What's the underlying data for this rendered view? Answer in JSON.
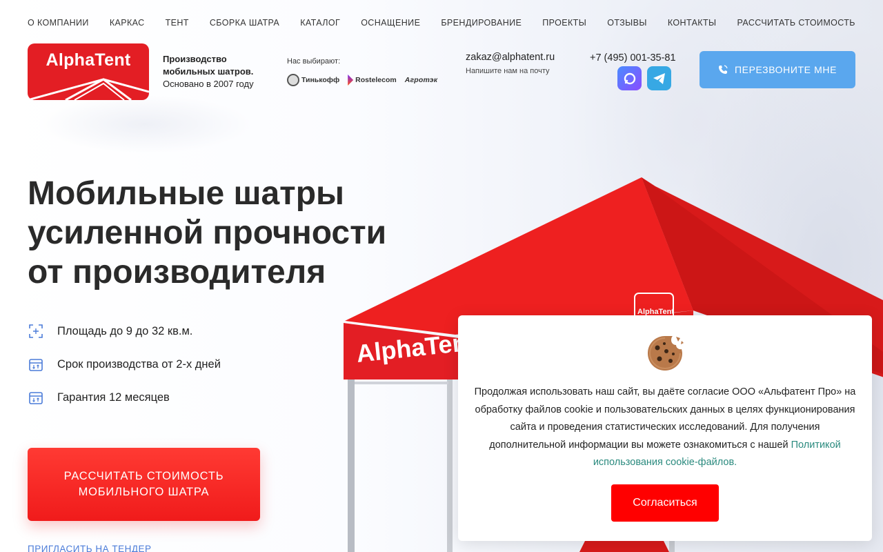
{
  "nav": {
    "items": [
      {
        "label": "О КОМПАНИИ"
      },
      {
        "label": "КАРКАС"
      },
      {
        "label": "ТЕНТ"
      },
      {
        "label": "СБОРКА ШАТРА"
      },
      {
        "label": "КАТАЛОГ"
      },
      {
        "label": "ОСНАЩЕНИЕ"
      },
      {
        "label": "БРЕНДИРОВАНИЕ"
      },
      {
        "label": "ПРОЕКТЫ"
      },
      {
        "label": "ОТЗЫВЫ"
      },
      {
        "label": "КОНТАКТЫ"
      },
      {
        "label": "РАССЧИТАТЬ СТОИМОСТЬ"
      }
    ]
  },
  "header": {
    "logo_text": "AlphaTent",
    "tagline_line1": "Производство",
    "tagline_line2": "мобильных шатров.",
    "tagline_line3": "Основано в 2007 году",
    "clients_label": "Нас выбирают:",
    "clients": [
      "Тинькофф",
      "Rostelecom",
      "Агротэк"
    ],
    "email": "zakaz@alphatent.ru",
    "email_note": "Напишите нам на почту",
    "phone": "+7 (495) 001-35-81",
    "callback_label": "ПЕРЕЗВОНИТЕ МНЕ",
    "messenger_icons": [
      "max-icon",
      "telegram-icon"
    ]
  },
  "hero": {
    "title_line1": "Мобильные шатры",
    "title_line2": "усиленной прочности",
    "title_line3": "от производителя",
    "features": [
      {
        "icon": "area-icon",
        "text": "Площадь до 9 до 32 кв.м."
      },
      {
        "icon": "calendar-icon",
        "text": "Срок производства от 2-х дней"
      },
      {
        "icon": "calendar-icon",
        "text": "Гарантия 12 месяцев"
      }
    ],
    "cta_line1": "РАССЧИТАТЬ СТОИМОСТЬ",
    "cta_line2": "МОБИЛЬНОГО ШАТРА",
    "tender_link": "ПРИГЛАСИТЬ НА ТЕНДЕР",
    "tent_brand_text": "AlphaTent",
    "tent_badge_text": "AlphaTent"
  },
  "cookie": {
    "text": "Продолжая использовать наш сайт, вы даёте согласие ООО «Альфатент Про» на обработку файлов cookie и пользовательских данных в целях функционирования сайта и проведения статистических исследований. Для получения дополнительной информации вы можете ознакомиться с нашей ",
    "link_text": "Политикой использования cookie-файлов.",
    "agree_label": "Согласиться"
  },
  "colors": {
    "brand_red": "#e31e24",
    "accent_blue": "#5aa7ee",
    "link_teal": "#2a8a7e",
    "agree_red": "#ff0000"
  }
}
